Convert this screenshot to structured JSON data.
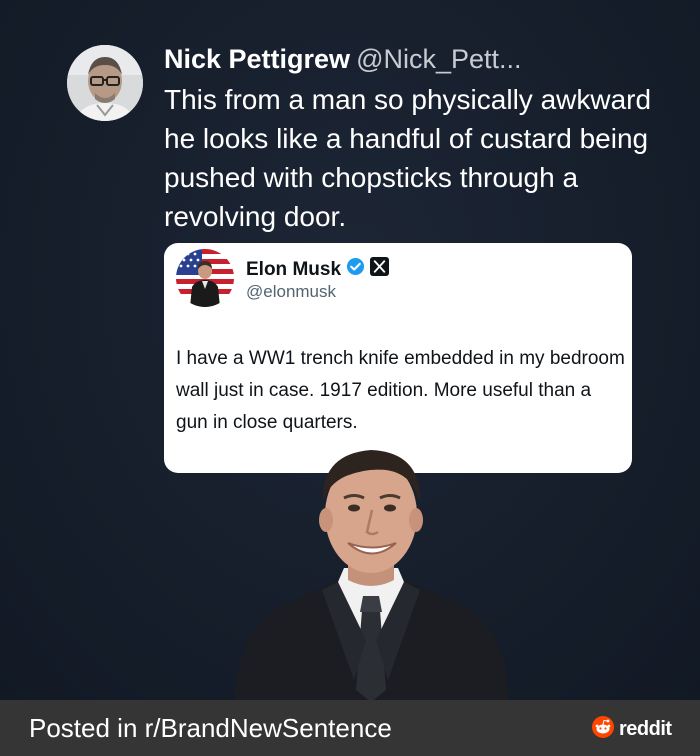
{
  "tweet": {
    "author_name": "Nick Pettigrew",
    "author_handle": "@Nick_Pett...",
    "text": "This from a man so physically awkward he looks like a handful of custard being pushed with chopsticks through a revolving door."
  },
  "quoted_tweet": {
    "author_name": "Elon Musk",
    "author_handle": "@elonmusk",
    "text": "I have a WW1 trench knife embedded in my bedroom wall just in case. 1917 edition. More useful than a gun in close quarters."
  },
  "footer": {
    "prefix": "Posted in r/",
    "subreddit": "BrandNewSentence",
    "brand": "reddit"
  },
  "colors": {
    "background": "#151d2a",
    "footer_bg": "#353535",
    "verified_blue": "#1d9bf0",
    "reddit_orange": "#ff4500"
  }
}
